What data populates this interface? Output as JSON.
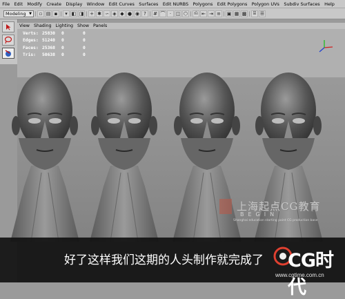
{
  "menubar": {
    "items": [
      "File",
      "Edit",
      "Modify",
      "Create",
      "Display",
      "Window",
      "Edit Curves",
      "Surfaces",
      "Edit NURBS",
      "Polygons",
      "Edit Polygons",
      "Polygon UVs",
      "Subdiv Surfaces",
      "Help"
    ]
  },
  "shelf": {
    "mode_value": "Modeling"
  },
  "panel_menu": {
    "items": [
      "View",
      "Shading",
      "Lighting",
      "Show",
      "Panels"
    ]
  },
  "stats": [
    {
      "label": "Verts:",
      "v1": "25830",
      "v2": "0",
      "v3": "0"
    },
    {
      "label": "Edges:",
      "v1": "51240",
      "v2": "0",
      "v3": "0"
    },
    {
      "label": "Faces:",
      "v1": "25368",
      "v2": "0",
      "v3": "0"
    },
    {
      "label": "Tris:",
      "v1": "50638",
      "v2": "0",
      "v3": "0"
    }
  ],
  "watermark": {
    "title": "上海起点CG教育",
    "begin": "BEGIN",
    "subtitle": "Shanghai education starting point CG production base"
  },
  "caption": {
    "text": "好了这样我们这期的人头制作就完成了"
  },
  "logo": {
    "name": "CG时代",
    "url": "www.cgtime.com.cn"
  },
  "colors": {
    "viewport_bg": "#9a9a9a",
    "axis_x": "#d02020",
    "axis_y": "#20c020",
    "axis_z": "#2040d0"
  }
}
